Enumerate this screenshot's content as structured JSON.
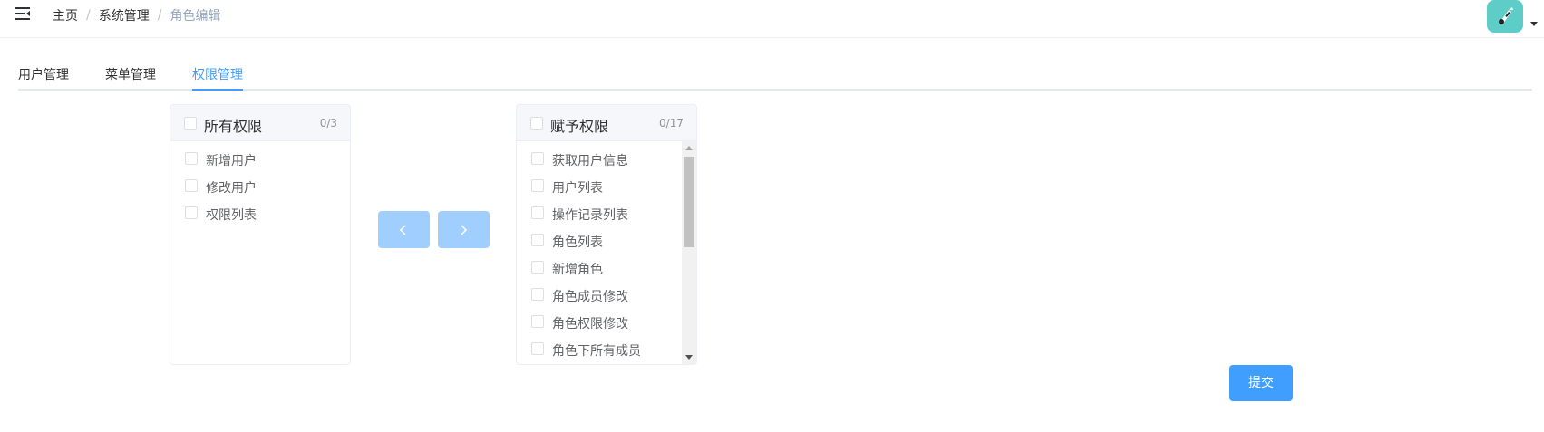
{
  "navbar": {
    "breadcrumb": [
      "主页",
      "系统管理",
      "角色编辑"
    ],
    "separator": "/",
    "icons": {
      "menu": "hamburger-menu-icon",
      "avatar": "user-avatar-icon",
      "dropdown": "caret-down-icon"
    },
    "avatar_color": "#5fcdc7"
  },
  "tabs": [
    {
      "label": "用户管理",
      "active": false
    },
    {
      "label": "菜单管理",
      "active": false
    },
    {
      "label": "权限管理",
      "active": true
    }
  ],
  "transfer": {
    "left": {
      "title": "所有权限",
      "count": "0/3",
      "items": [
        "新增用户",
        "修改用户",
        "权限列表"
      ]
    },
    "right": {
      "title": "赋予权限",
      "count": "0/17",
      "items": [
        "获取用户信息",
        "用户列表",
        "操作记录列表",
        "角色列表",
        "新增角色",
        "角色成员修改",
        "角色权限修改",
        "角色下所有成员"
      ]
    },
    "buttons": {
      "to_left_icon": "chevron-left-icon",
      "to_right_icon": "chevron-right-icon"
    }
  },
  "submit_label": "提交",
  "colors": {
    "primary": "#409eff",
    "primary_disabled": "#a0cfff",
    "breadcrumb_current": "#97a8be"
  }
}
